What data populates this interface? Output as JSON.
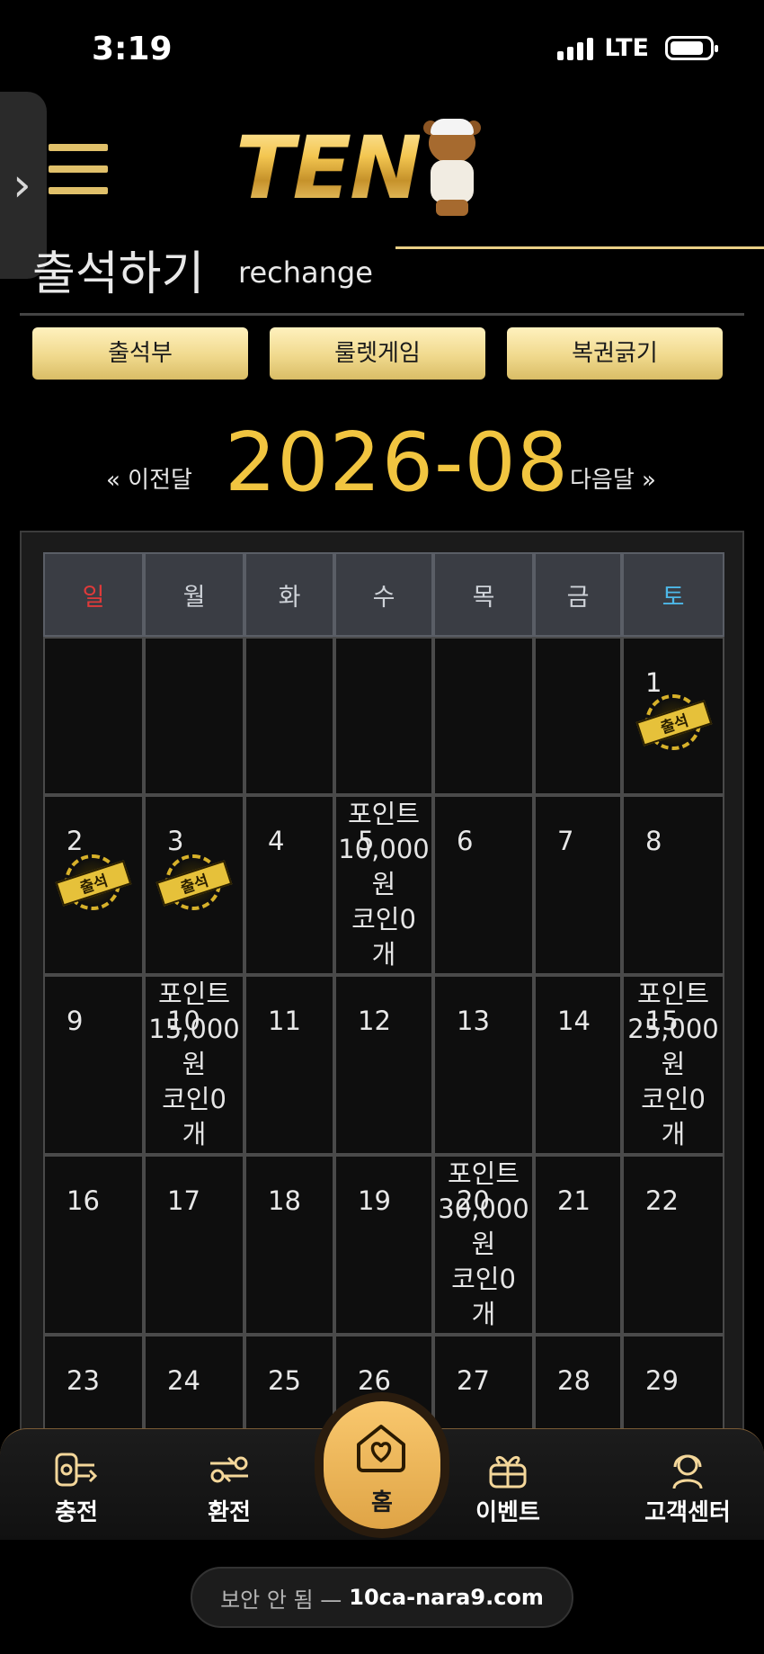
{
  "status_bar": {
    "time": "3:19",
    "network": "LTE"
  },
  "header": {
    "logo_text": "TEN"
  },
  "page": {
    "title": "출석하기",
    "subtitle": "rechange"
  },
  "tabs": [
    {
      "label": "출석부"
    },
    {
      "label": "룰렛게임"
    },
    {
      "label": "복권긁기"
    }
  ],
  "month_nav": {
    "prev_label": "« 이전달",
    "current": "2026-08",
    "next_label": "다음달 »"
  },
  "calendar": {
    "weekdays": [
      "일",
      "월",
      "화",
      "수",
      "목",
      "금",
      "토"
    ],
    "colors": {
      "sunday": "#e03a3a",
      "saturday": "#4db8e8",
      "accent_gold": "#f1c540"
    },
    "stamp_label": "출석",
    "days": {
      "d1": "1",
      "d2": "2",
      "d3": "3",
      "d4": "4",
      "d5": "5",
      "d6": "6",
      "d7": "7",
      "d8": "8",
      "d9": "9",
      "d10": "10",
      "d11": "11",
      "d12": "12",
      "d13": "13",
      "d14": "14",
      "d15": "15",
      "d16": "16",
      "d17": "17",
      "d18": "18",
      "d19": "19",
      "d20": "20",
      "d21": "21",
      "d22": "22",
      "d23": "23",
      "d24": "24",
      "d25": "25",
      "d26": "26",
      "d27": "27",
      "d28": "28",
      "d29": "29"
    },
    "attended_days": [
      "1",
      "2",
      "3"
    ],
    "rewards": {
      "d5": {
        "line1": "포인트",
        "line2": "10,000",
        "line3": "원",
        "line4": "코인0",
        "line5": "개"
      },
      "d10": {
        "line1": "포인트",
        "line2": "15,000",
        "line3": "원",
        "line4": "코인0",
        "line5": "개"
      },
      "d15": {
        "line1": "포인트",
        "line2": "25,000",
        "line3": "원",
        "line4": "코인0",
        "line5": "개"
      },
      "d20": {
        "line1": "포인트",
        "line2": "30,000",
        "line3": "원",
        "line4": "코인0",
        "line5": "개"
      }
    }
  },
  "bottom_nav": {
    "items": [
      {
        "label": "충전",
        "icon": "charge-icon"
      },
      {
        "label": "환전",
        "icon": "exchange-icon"
      },
      {
        "label": "홈",
        "icon": "home-heart-icon"
      },
      {
        "label": "이벤트",
        "icon": "gift-icon"
      },
      {
        "label": "고객센터",
        "icon": "support-agent-icon"
      }
    ]
  },
  "browser": {
    "insecure_label": "보안 안 됨 —",
    "host": "10ca-nara9.com"
  }
}
